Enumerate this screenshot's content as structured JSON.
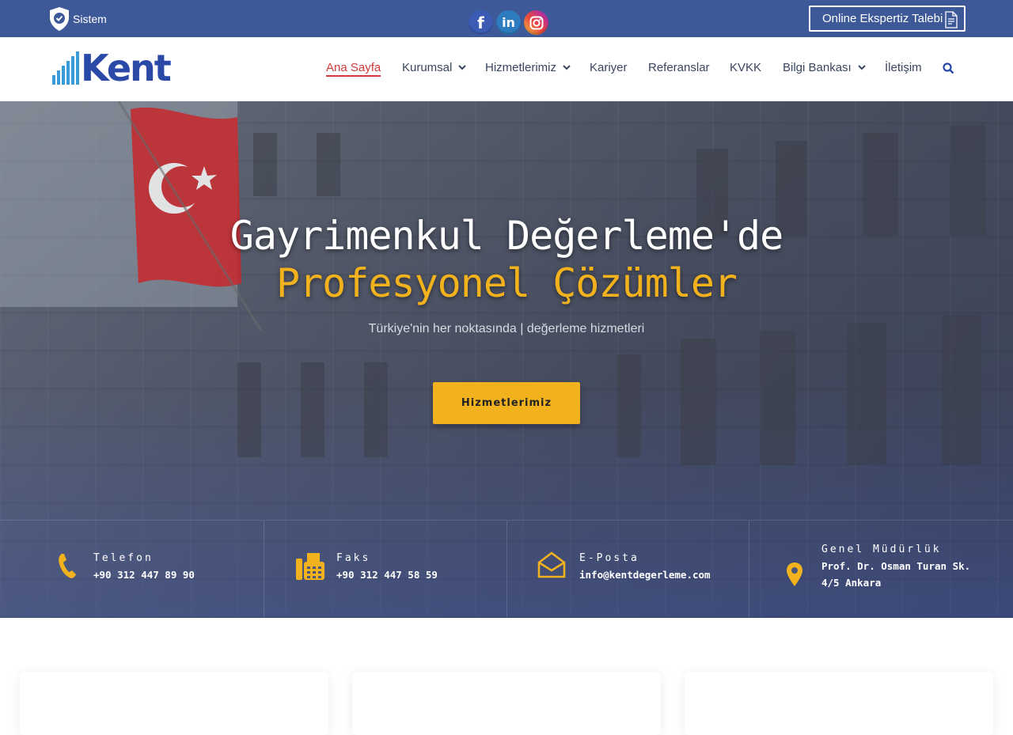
{
  "topbar": {
    "sistem_label": "Sistem",
    "social": [
      "facebook-icon",
      "linkedin-icon",
      "instagram-icon"
    ],
    "cta_label": "Online Ekspertiz Talebi"
  },
  "nav": {
    "logo_text": "Kent",
    "items": [
      {
        "label": "Ana Sayfa",
        "active": true,
        "dropdown": false
      },
      {
        "label": "Kurumsal",
        "active": false,
        "dropdown": true
      },
      {
        "label": "Hizmetlerimiz",
        "active": false,
        "dropdown": true
      },
      {
        "label": "Kariyer",
        "active": false,
        "dropdown": false
      },
      {
        "label": "Referanslar",
        "active": false,
        "dropdown": false
      },
      {
        "label": "KVKK",
        "active": false,
        "dropdown": false
      },
      {
        "label": "Bilgi Bankası",
        "active": false,
        "dropdown": true
      },
      {
        "label": "İletişim",
        "active": false,
        "dropdown": false
      }
    ]
  },
  "hero": {
    "title_line1": "Gayrimenkul Değerleme'de",
    "title_line2": "Profesyonel Çözümler",
    "subtitle": "Türkiye'nin her noktasında | değerleme hizmetleri",
    "button_label": "Hizmetlerimiz"
  },
  "contact": {
    "phone": {
      "label": "Telefon",
      "value": "+90 312 447 89 90"
    },
    "fax": {
      "label": "Faks",
      "value": "+90 312 447 58 59"
    },
    "email": {
      "label": "E-Posta",
      "value": "info@kentdegerleme.com"
    },
    "hq": {
      "label": "Genel Müdürlük",
      "line1": "Prof. Dr. Osman Turan Sk.",
      "line2": "4/5 Ankara"
    }
  },
  "colors": {
    "topbar": "#3e5998",
    "accent": "#f2b21e",
    "active_nav": "#d13a3a",
    "brand": "#2b4aa8"
  }
}
